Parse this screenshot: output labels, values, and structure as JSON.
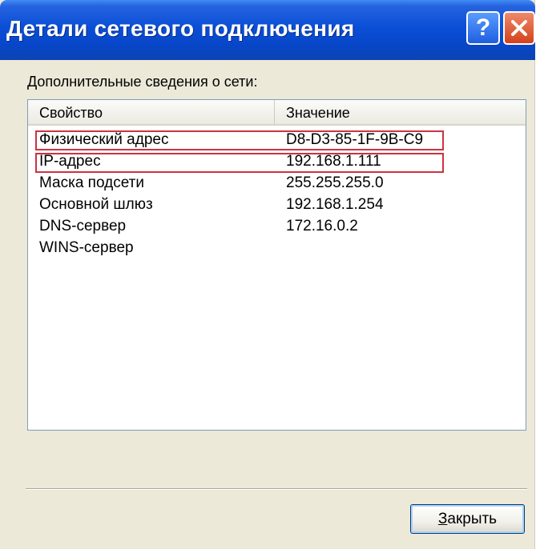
{
  "window": {
    "title": "Детали сетевого подключения",
    "help_symbol": "?",
    "close_symbol": "✕"
  },
  "group_label": "Дополнительные сведения о сети:",
  "table": {
    "columns": [
      "Свойство",
      "Значение"
    ],
    "rows": [
      {
        "property": "Физический адрес",
        "value": "D8-D3-85-1F-9B-C9",
        "highlighted": true
      },
      {
        "property": "IP-адрес",
        "value": "192.168.1.111",
        "highlighted": true
      },
      {
        "property": "Маска подсети",
        "value": "255.255.255.0",
        "highlighted": false
      },
      {
        "property": "Основной шлюз",
        "value": "192.168.1.254",
        "highlighted": false
      },
      {
        "property": "DNS-сервер",
        "value": "172.16.0.2",
        "highlighted": false
      },
      {
        "property": "WINS-сервер",
        "value": "",
        "highlighted": false
      }
    ]
  },
  "close_button": {
    "mnemonic": "З",
    "rest": "акрыть"
  },
  "colors": {
    "titlebar": "#0846c9",
    "highlight_box": "#cc3340",
    "dialog_background": "#ece9d8"
  }
}
